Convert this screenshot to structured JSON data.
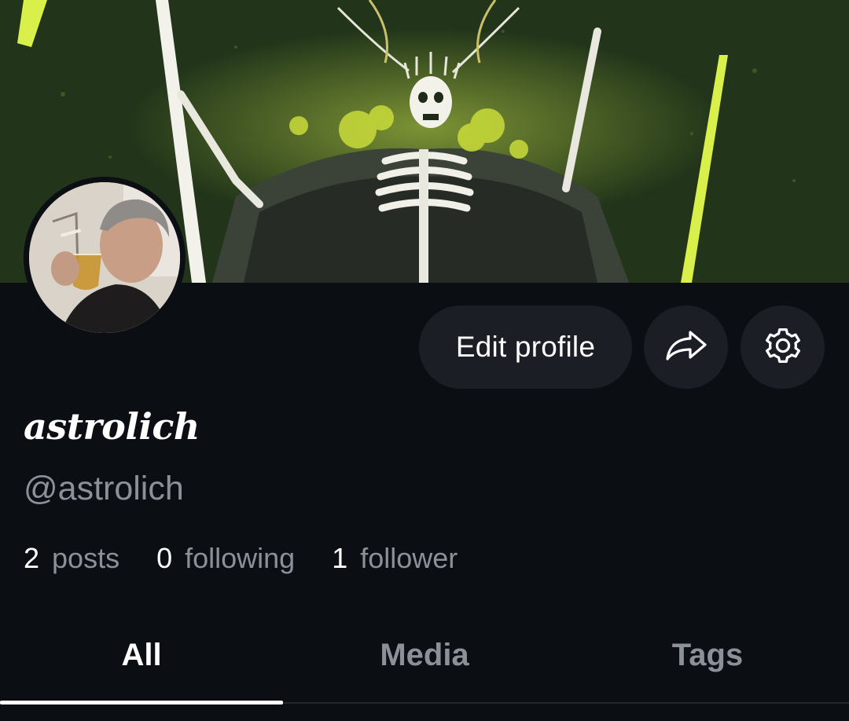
{
  "profile": {
    "display_name": "astrolich",
    "handle": "@astrolich"
  },
  "actions": {
    "edit_profile_label": "Edit profile",
    "share_icon": "share-arrow-icon",
    "settings_icon": "gear-icon"
  },
  "stats": [
    {
      "count": "2",
      "label": "posts"
    },
    {
      "count": "0",
      "label": "following"
    },
    {
      "count": "1",
      "label": "follower"
    }
  ],
  "tabs": [
    {
      "label": "All",
      "active": true
    },
    {
      "label": "Media",
      "active": false
    },
    {
      "label": "Tags",
      "active": false
    }
  ],
  "colors": {
    "background": "#0b0e13",
    "button_bg": "#1b1f25",
    "text_primary": "#ffffff",
    "text_secondary": "#8b9099",
    "banner_green": "#2f4a1c",
    "banner_accent": "#d9f04a"
  }
}
